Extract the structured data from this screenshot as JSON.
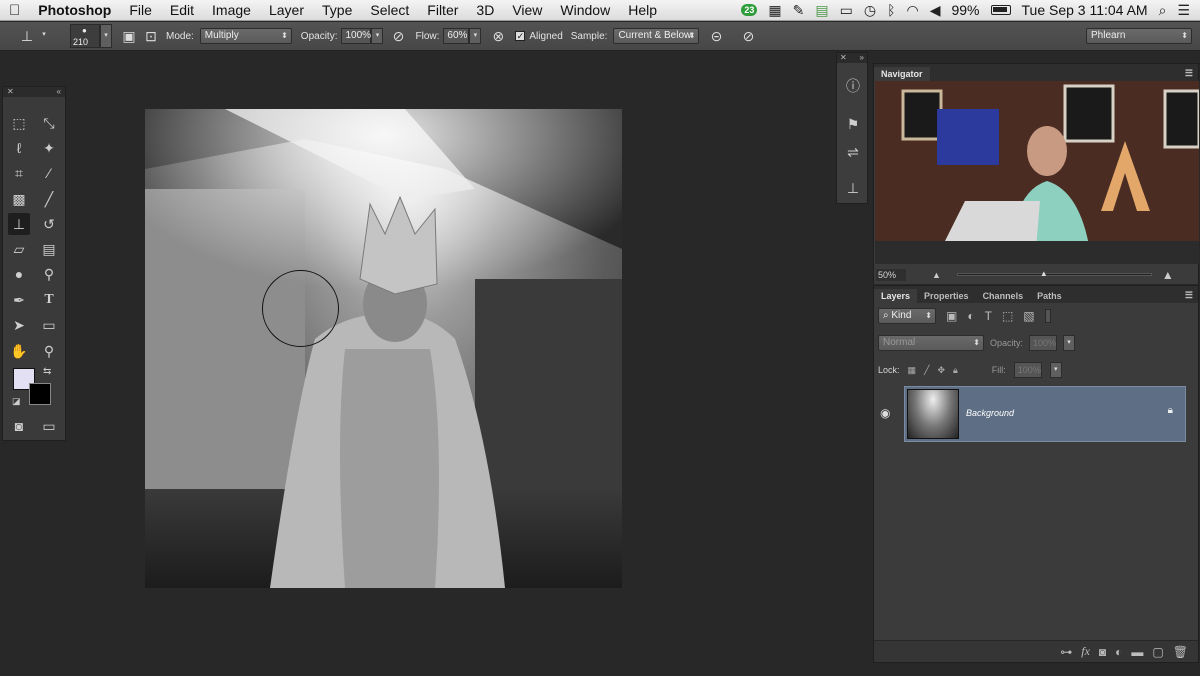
{
  "menubar": {
    "app": "Photoshop",
    "items": [
      "File",
      "Edit",
      "Image",
      "Layer",
      "Type",
      "Select",
      "Filter",
      "3D",
      "View",
      "Window",
      "Help"
    ],
    "badge": "23",
    "battery": "99%",
    "datetime": "Tue Sep 3  11:04 AM"
  },
  "options": {
    "brush_size": "210",
    "mode_label": "Mode:",
    "mode_value": "Multiply",
    "opacity_label": "Opacity:",
    "opacity_value": "100%",
    "flow_label": "Flow:",
    "flow_value": "60%",
    "aligned_label": "Aligned",
    "sample_label": "Sample:",
    "sample_value": "Current & Below",
    "workspace": "Phlearn"
  },
  "navigator": {
    "tab": "Navigator",
    "zoom": "50%"
  },
  "layers_panel": {
    "tabs": [
      "Layers",
      "Properties",
      "Channels",
      "Paths"
    ],
    "filter_kind": "Kind",
    "blend_mode": "Normal",
    "opacity_label": "Opacity:",
    "opacity_value": "100%",
    "lock_label": "Lock:",
    "fill_label": "Fill:",
    "fill_value": "100%",
    "layer_name": "Background"
  },
  "colors": {
    "foreground": "#e2e0f2",
    "background": "#000000",
    "layer_selected": "#5e6f85"
  }
}
